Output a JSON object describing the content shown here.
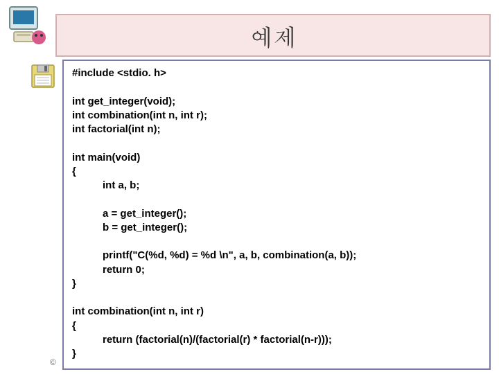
{
  "title": "예제",
  "code": {
    "l01": "#include <stdio. h>",
    "l02": "int get_integer(void);",
    "l03": "int combination(int n, int r);",
    "l04": "int factorial(int n);",
    "l05": "int main(void)",
    "l06": "{",
    "l07": "int a, b;",
    "l08": "a = get_integer();",
    "l09": "b = get_integer();",
    "l10": "printf(\"C(%d, %d) = %d \\n\", a, b, combination(a, b));",
    "l11": "return 0;",
    "l12": "}",
    "l13": "int combination(int n, int r)",
    "l14": "{",
    "l15": "return (factorial(n)/(factorial(r) * factorial(n-r)));",
    "l16": "}"
  },
  "copyright": "©",
  "icons": {
    "computer": "computer-icon",
    "disk": "floppy-disk-icon"
  }
}
